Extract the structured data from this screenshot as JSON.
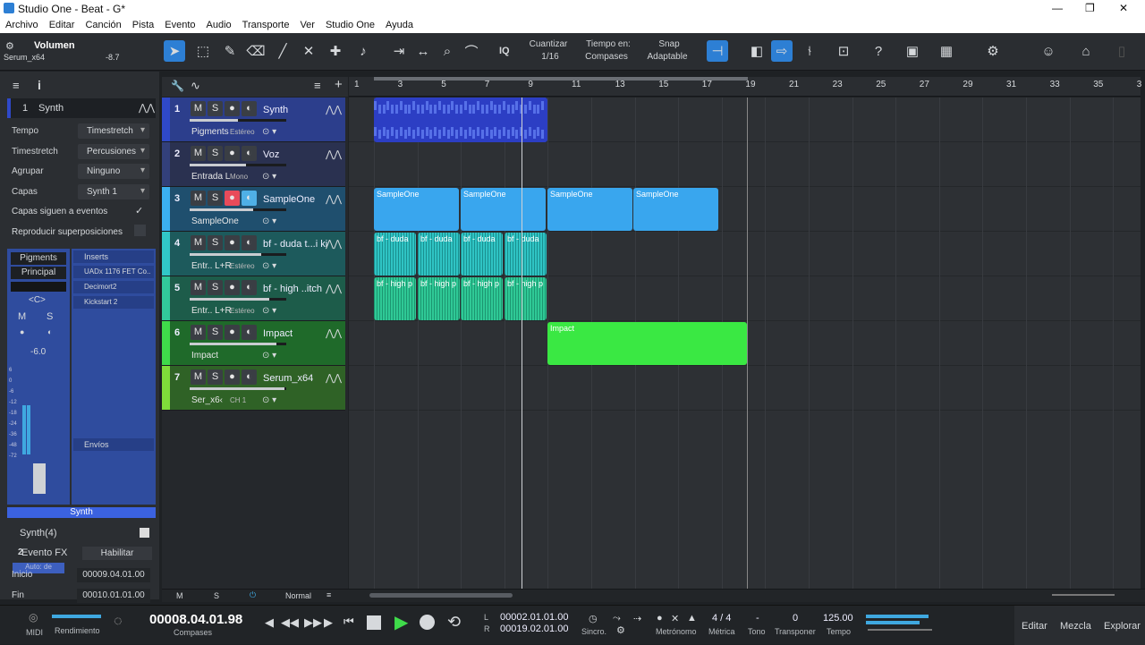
{
  "window": {
    "title": "Studio One - Beat - G*",
    "controls": [
      "—",
      "❐",
      "✕"
    ]
  },
  "menu": [
    "Archivo",
    "Editar",
    "Canción",
    "Pista",
    "Evento",
    "Audio",
    "Transporte",
    "Ver",
    "Studio One",
    "Ayuda"
  ],
  "toolbar": {
    "param_name": "Volumen",
    "param_device": "Serum_x64",
    "param_value": "-8.7",
    "quantize_label": "Cuantizar",
    "quantize_value": "1/16",
    "timebase_label": "Tiempo en:",
    "timebase_value": "Compases",
    "snap_label": "Snap",
    "snap_value": "Adaptable",
    "iq": "IQ"
  },
  "inspector": {
    "track_num": "1",
    "track_name": "Synth",
    "rows": [
      {
        "k": "Tempo",
        "v": "Timestretch"
      },
      {
        "k": "Timestretch",
        "v": "Percusiones"
      },
      {
        "k": "Agrupar",
        "v": "Ninguno"
      },
      {
        "k": "Capas",
        "v": "Synth 1"
      }
    ],
    "check1": "Capas siguen a eventos",
    "check2": "Reproducir superposiciones",
    "instrument": "Pigments",
    "output": "Principal",
    "pan": "<C>",
    "mute": "M",
    "solo": "S",
    "volume_value": "-6.0",
    "channel_num": "2",
    "auto": "Auto: de",
    "channel_name": "Synth",
    "fader_scale": [
      "6",
      "0",
      "-6",
      "-12",
      "-18",
      "-24",
      "-36",
      "-48",
      "-72"
    ],
    "inserts_label": "Inserts",
    "inserts": [
      "UADx 1176 FET Co..",
      "Decimort2",
      "Kickstart 2"
    ],
    "sends_label": "Envíos",
    "event_name": "Synth(4)",
    "event_fx": "Evento FX",
    "enable": "Habilitar",
    "start_label": "Inicio",
    "start_value": "00009.04.01.00",
    "end_label": "Fin",
    "end_value": "00010.01.01.00"
  },
  "tracks": [
    {
      "num": "1",
      "name": "Synth",
      "sub": "Pigments",
      "sub2": "Estéreo",
      "color": "#2f49c9",
      "bg": "#2c3e8c",
      "rec": false
    },
    {
      "num": "2",
      "name": "Voz",
      "sub": "Entrada L",
      "sub2": "Mono",
      "color": "#33407a",
      "bg": "#2a3150",
      "rec": false
    },
    {
      "num": "3",
      "name": "SampleOne",
      "sub": "SampleOne",
      "sub2": "",
      "color": "#3bb0f0",
      "bg": "#1f4f6e",
      "rec": true
    },
    {
      "num": "4",
      "name": "bf - duda t...i ki",
      "sub": "Entr.. L+R",
      "sub2": "Estéreo",
      "color": "#31c7c7",
      "bg": "#1d5a5c",
      "rec": false
    },
    {
      "num": "5",
      "name": "bf - high ..itch",
      "sub": "Entr.. L+R",
      "sub2": "Estéreo",
      "color": "#32c99a",
      "bg": "#1d5c4a",
      "rec": false
    },
    {
      "num": "6",
      "name": "Impact",
      "sub": "Impact",
      "sub2": "",
      "color": "#3fdb4a",
      "bg": "#1f6a2a",
      "rec": false
    },
    {
      "num": "7",
      "name": "Serum_x64",
      "sub": "Ser_x6‹",
      "sub2": "CH 1",
      "color": "#7fdc3a",
      "bg": "#2f6226",
      "rec": false
    }
  ],
  "ruler": [
    "1",
    "3",
    "5",
    "7",
    "9",
    "11",
    "13",
    "15",
    "17",
    "19",
    "21",
    "23",
    "25",
    "27",
    "29",
    "31",
    "33",
    "35",
    "3"
  ],
  "clips": {
    "sampleone": [
      "SampleOne",
      "SampleOne",
      "SampleOne",
      "SampleOne"
    ],
    "duda": [
      "bf - duda",
      "bf - duda",
      "bf - duda",
      "bf - duda"
    ],
    "high": [
      "bf - high p",
      "bf - high p",
      "bf - high p",
      "bf - high p"
    ],
    "impact": "Impact"
  },
  "bottom": {
    "m": "M",
    "s": "S",
    "mode": "Normal"
  },
  "transport": {
    "midi": "MIDI",
    "perf": "Rendimiento",
    "position": "00008.04.01.98",
    "position_unit": "Compases",
    "loop_l": "00002.01.01.00",
    "loop_r": "00019.02.01.00",
    "l": "L",
    "r": "R",
    "sync": "Sincro.",
    "metro": "Metrónomo",
    "sig": "4 / 4",
    "sig_label": "Métrica",
    "key": "-",
    "key_label": "Tono",
    "transpose": "0",
    "transpose_label": "Transponer",
    "tempo": "125.00",
    "tempo_label": "Tempo",
    "views": [
      "Editar",
      "Mezcla",
      "Explorar"
    ]
  }
}
